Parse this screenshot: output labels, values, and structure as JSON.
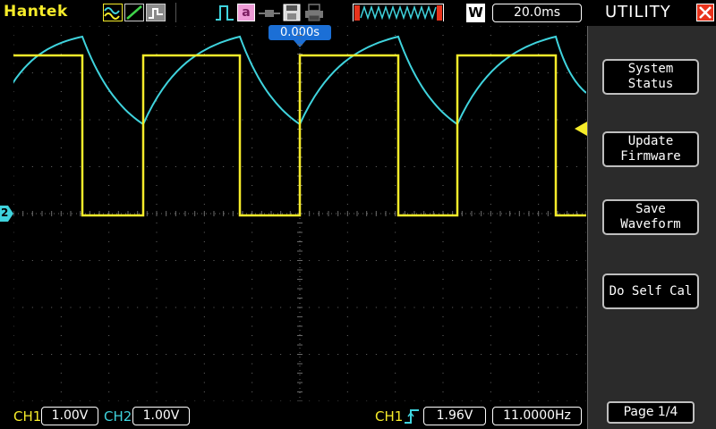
{
  "brand": "Hantek",
  "topbar": {
    "timebase": "20.0ms",
    "trigger_offset": "0.000s",
    "mode_letter": "W",
    "icons": [
      "waveform-icon",
      "line-mode-icon",
      "persist-icon",
      "pulse-trigger-icon",
      "auto-a-icon",
      "probe-icon",
      "save-icon",
      "print-icon",
      "memory-depth-icon",
      "waveform-W-icon"
    ]
  },
  "menu": {
    "title": "UTILITY",
    "close_label": "X",
    "buttons": [
      {
        "label": "System\nStatus"
      },
      {
        "label": "Update\nFirmware"
      },
      {
        "label": "Save\nWaveform"
      },
      {
        "label": "Do Self Cal"
      }
    ],
    "page": "Page 1/4"
  },
  "bottombar": {
    "ch1_label": "CH1",
    "ch1_volts": "1.00V",
    "ch2_label": "CH2",
    "ch2_volts": "1.00V",
    "trig_label": "CH1",
    "trig_level": "1.96V",
    "frequency": "11.0000Hz"
  },
  "markers": {
    "ch2_marker": "2"
  },
  "colors": {
    "ch1": "#f6ec2a",
    "ch2": "#3fd3dd",
    "grid": "#6a6a6a",
    "menu_bg": "#2b2b2b",
    "accent_blue": "#1b6fd6",
    "close_red": "#e8331c"
  }
}
